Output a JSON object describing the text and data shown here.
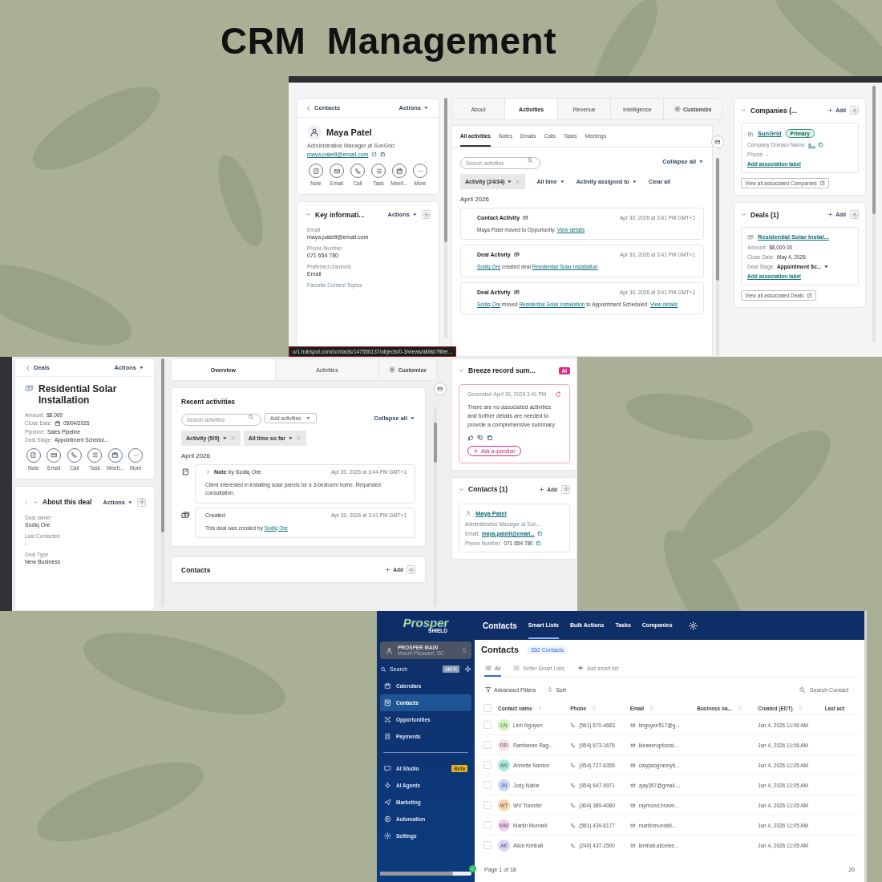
{
  "title": "CRM  Management",
  "contact_record": {
    "back": "Contacts",
    "actions": "Actions",
    "name": "Maya Patel",
    "subtitle": "Administrative Manager at SunGrid",
    "email": "maya.patelll@email.com",
    "quick_actions": [
      {
        "label": "Note",
        "kind": "note"
      },
      {
        "label": "Email",
        "kind": "email"
      },
      {
        "label": "Call",
        "kind": "call"
      },
      {
        "label": "Task",
        "kind": "task"
      },
      {
        "label": "Meeti...",
        "kind": "meeting"
      },
      {
        "label": "More",
        "kind": "more"
      }
    ],
    "key_info": {
      "title": "Key informati...",
      "actions": "Actions",
      "fields": [
        {
          "label": "Email",
          "value": "maya.patelll@email.com"
        },
        {
          "label": "Phone Number",
          "value": "071 654 780"
        },
        {
          "label": "Preferred channels",
          "value": "Email"
        },
        {
          "label": "Favorite Content Topics"
        }
      ]
    },
    "url": "u/1.hubspot.com/contacts/147556137/objects/0-3/views/all/list?filter...",
    "tabs": [
      {
        "label": "About",
        "selected": false
      },
      {
        "label": "Activities",
        "selected": true
      },
      {
        "label": "Revenue",
        "selected": false
      },
      {
        "label": "Intelligence",
        "selected": false
      }
    ],
    "customize": "Customize",
    "subtabs": [
      {
        "label": "All activities",
        "selected": true
      },
      {
        "label": "Notes",
        "selected": false
      },
      {
        "label": "Emails",
        "selected": false
      },
      {
        "label": "Calls",
        "selected": false
      },
      {
        "label": "Tasks",
        "selected": false
      },
      {
        "label": "Meetings",
        "selected": false
      }
    ],
    "search": {
      "placeholder": "Search activities"
    },
    "collapse": "Collapse all",
    "filters": [
      {
        "label": "Activity (24/34)",
        "kind": "chip"
      },
      {
        "label": "All time",
        "kind": "dropdown"
      },
      {
        "label": "Activity assigned to",
        "kind": "dropdown"
      },
      {
        "label": "Clear all",
        "kind": "link"
      }
    ],
    "month": "April 2026",
    "activities": [
      {
        "title": "Contact Activity",
        "kind": "contact",
        "time": "Apr 30, 2026 at 3:41 PM GMT+1",
        "parts": [
          {
            "text": "Maya Patel moved to Opportunity.",
            "link": false
          },
          {
            "text": "View details",
            "link": true
          }
        ]
      },
      {
        "title": "Deal Activity",
        "kind": "deal",
        "time": "Apr 30, 2026 at 3:41 PM GMT+1",
        "parts": [
          {
            "text": "Sodiq Ore",
            "link": true
          },
          {
            "text": "created deal",
            "link": false
          },
          {
            "text": "Residential Solar Installation",
            "link": true
          }
        ]
      },
      {
        "title": "Deal Activity",
        "kind": "deal",
        "time": "Apr 30, 2026 at 3:41 PM GMT+1",
        "parts": [
          {
            "text": "Sodiq Ore",
            "link": true
          },
          {
            "text": "moved",
            "link": false
          },
          {
            "text": "Residential Solar Installation",
            "link": true
          },
          {
            "text": "to Appointment Scheduled.",
            "link": false
          },
          {
            "text": "View details",
            "link": true
          }
        ]
      }
    ],
    "companies": {
      "title": "Companies (...",
      "add": "Add",
      "name": "SunGrid",
      "badge": "Primary",
      "fields": [
        {
          "label": "Company Domain Name:",
          "value": "s...",
          "kind": "link"
        },
        {
          "label": "Phone: --",
          "kind": "plain"
        }
      ],
      "assoc": "Add association label",
      "view_all": "View all associated Companies"
    },
    "deals": {
      "title": "Deals (1)",
      "add": "Add",
      "name": "Residential Solar Instal...",
      "fields": [
        {
          "label": "Amount:",
          "value": "$8,000.00",
          "kind": "plain"
        },
        {
          "label": "Close Date:",
          "value": "May 4, 2026",
          "kind": "plain"
        },
        {
          "label": "Deal Stage:",
          "value": "Appointment Sc...",
          "kind": "dropdown"
        }
      ],
      "assoc": "Add association label",
      "view_all": "View all associated Deals"
    }
  },
  "deal_record": {
    "back": "Deals",
    "actions": "Actions",
    "name": "Residential Solar Installation",
    "fields": [
      {
        "label": "Amount:",
        "value": "$8,000",
        "kind": "plain"
      },
      {
        "label": "Close Date:",
        "value": "05/04/2026",
        "kind": "date"
      },
      {
        "label": "Pipeline:",
        "value": "Sales Pipeline",
        "kind": "plain"
      },
      {
        "label": "Deal Stage:",
        "value": "Appointment Schedul...",
        "kind": "plain"
      }
    ],
    "quick_actions": [
      {
        "label": "Note",
        "kind": "note"
      },
      {
        "label": "Email",
        "kind": "email"
      },
      {
        "label": "Call",
        "kind": "call"
      },
      {
        "label": "Task",
        "kind": "task"
      },
      {
        "label": "Meeti...",
        "kind": "meeting"
      },
      {
        "label": "More",
        "kind": "more"
      }
    ],
    "about": {
      "title": "About this deal",
      "actions": "Actions",
      "fields": [
        {
          "label": "Deal owner",
          "value": "Sodiq Ore"
        },
        {
          "label": "Last Contacted",
          "value": "-"
        },
        {
          "label": "Deal Type",
          "value": "New Business"
        }
      ]
    },
    "tabs": [
      {
        "label": "Overview",
        "selected": true
      },
      {
        "label": "Activities",
        "selected": false
      }
    ],
    "customize": "Customize",
    "recent_title": "Recent activities",
    "search": {
      "placeholder": "Search activities"
    },
    "add_activities": "Add activities",
    "collapse": "Collapse all",
    "filters": [
      {
        "label": "Activity (5/9)"
      },
      {
        "label": "All time so far"
      }
    ],
    "month": "April 2026",
    "timeline": [
      {
        "kind": "note",
        "title": "**Note** by Sodiq Ore",
        "time": "Apr 30, 2026 at 3:44 PM GMT+1",
        "parts": [
          {
            "text": "Client interested in installing solar panels for a 3-bedroom home. Requested consultation.",
            "link": false
          }
        ]
      },
      {
        "kind": "deal",
        "title": "Created",
        "time": "Apr 30, 2026 at 3:41 PM GMT+1",
        "parts": [
          {
            "text": "This deal was created by",
            "link": false
          },
          {
            "text": "Sodiq Ore",
            "link": true
          }
        ]
      }
    ],
    "contacts_title": "Contacts",
    "contacts_add": "Add",
    "breeze": {
      "title": "Breeze record sum...",
      "badge": "AI",
      "generated": "Generated April 30, 2026 3:41 PM",
      "summary": "There are no associated activities and further details are needed to provide a comprehensive summary",
      "ask": "Ask a question"
    },
    "contacts": {
      "title": "Contacts (1)",
      "add": "Add",
      "name": "Maya Patel",
      "subtitle": "Administrative Manager at Sun...",
      "fields": [
        {
          "label": "Email:",
          "value": "maya.patelll@email...",
          "kind": "link"
        },
        {
          "label": "Phone Number:",
          "value": "071 654 780",
          "kind": "plain"
        }
      ]
    }
  },
  "contacts_app": {
    "logo": "Prosper",
    "logo_sub": "SHIELD",
    "section": "Contacts",
    "nav": [
      {
        "label": "Smart Lists",
        "selected": true
      },
      {
        "label": "Bulk Actions",
        "selected": false
      },
      {
        "label": "Tasks",
        "selected": false
      },
      {
        "label": "Companies",
        "selected": false
      }
    ],
    "account": {
      "name": "PROSPER MAIN",
      "location": "Mount Pleasant, SC"
    },
    "search": "Search",
    "shortcut": "ctrl K",
    "sidebar": [
      {
        "label": "Calendars",
        "kind": "calendar",
        "selected": false
      },
      {
        "label": "Contacts",
        "kind": "contact",
        "selected": true
      },
      {
        "label": "Opportunities",
        "kind": "funnel",
        "selected": false
      },
      {
        "label": "Payments",
        "kind": "receipt",
        "selected": false
      },
      {
        "label": "AI Studio",
        "kind": "chat",
        "selected": false,
        "badge": "Beta"
      },
      {
        "label": "AI Agents",
        "kind": "sparkle",
        "selected": false
      },
      {
        "label": "Marketing",
        "kind": "send",
        "selected": false
      },
      {
        "label": "Automation",
        "kind": "play",
        "selected": false
      },
      {
        "label": "Settings",
        "kind": "gear",
        "selected": false
      }
    ],
    "title": "Contacts",
    "count": "352 Contacts",
    "list_tabs": [
      {
        "label": "All",
        "selected": true
      },
      {
        "label": "Setter Smart Lists",
        "selected": false
      }
    ],
    "add_list": "Add smart list",
    "advanced": "Advanced Filters",
    "sort": "Sort",
    "search_placeholder": "Search Contact",
    "select_all": {
      "checked": false
    },
    "columns": [
      "Contact name",
      "Phone",
      "Email",
      "Business na...",
      "Created (EDT)",
      "Last act"
    ],
    "rows": [
      {
        "initials": "LN",
        "color": "#d5f5c0",
        "name": "Linh Nguyen",
        "phone": "(561) 670-4683",
        "email": "tinguyen517@g...",
        "created": "Jun 4, 2026 11:06 AM",
        "checked": false
      },
      {
        "initials": "RR",
        "color": "#f7e1e7",
        "name": "Ramberan Rag...",
        "phone": "(954) 673-1676",
        "email": "kleaneroptionsi...",
        "created": "Jun 4, 2026 11:06 AM",
        "checked": false
      },
      {
        "initials": "AN",
        "color": "#a6ecd8",
        "name": "Annette Nanton",
        "phone": "(954) 727-6355",
        "email": "calypsogranny6...",
        "created": "Jun 4, 2026 11:05 AM",
        "checked": false
      },
      {
        "initials": "JN",
        "color": "#c8d7f7",
        "name": "Judy Nable",
        "phone": "(954) 647-9971",
        "email": "zjay357@gmail....",
        "created": "Jun 4, 2026 11:05 AM",
        "checked": false
      },
      {
        "initials": "WT",
        "color": "#fbd6ad",
        "name": "WV Transfer",
        "phone": "(304) 389-4080",
        "email": "raymond.brown...",
        "created": "Jun 4, 2026 11:05 AM",
        "checked": false
      },
      {
        "initials": "MM",
        "color": "#f3cdef",
        "name": "Martin Mundell",
        "phone": "(561) 439-6177",
        "email": "martinmundell...",
        "created": "Jun 4, 2026 11:05 AM",
        "checked": false
      },
      {
        "initials": "AK",
        "color": "#dcd5f7",
        "name": "Alice Kimball",
        "phone": "(240) 437-1500",
        "email": "kimball.alicelee...",
        "created": "Jun 4, 2026 11:05 AM",
        "checked": false
      }
    ],
    "page": "Page 1 of 18",
    "per_page": "20"
  }
}
